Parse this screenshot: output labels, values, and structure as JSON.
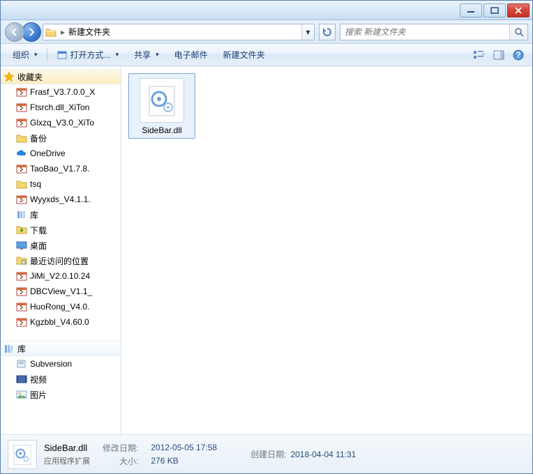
{
  "titlebar": {},
  "address": {
    "folder_name": "新建文件夹",
    "search_placeholder": "搜索 新建文件夹"
  },
  "toolbar": {
    "organize": "组织",
    "open_with": "打开方式...",
    "share": "共享",
    "email": "电子邮件",
    "new_folder": "新建文件夹"
  },
  "sidebar": {
    "favorites_label": "收藏夹",
    "fav_items": [
      {
        "label": "Frasf_V3.7.0.0_X",
        "icon": "archive"
      },
      {
        "label": "Ftsrch.dll_XiTon",
        "icon": "archive"
      },
      {
        "label": "Glxzq_V3.0_XiTo",
        "icon": "archive"
      },
      {
        "label": "备份",
        "icon": "folder"
      },
      {
        "label": "OneDrive",
        "icon": "onedrive"
      },
      {
        "label": "TaoBao_V1.7.8.",
        "icon": "archive"
      },
      {
        "label": "tsq",
        "icon": "folder"
      },
      {
        "label": "Wyyxds_V4.1.1.",
        "icon": "archive"
      },
      {
        "label": "库",
        "icon": "library"
      },
      {
        "label": "下载",
        "icon": "download"
      },
      {
        "label": "桌面",
        "icon": "desktop"
      },
      {
        "label": "最近访问的位置",
        "icon": "recent"
      },
      {
        "label": "JiMi_V2.0.10.24",
        "icon": "archive"
      },
      {
        "label": "DBCView_V1.1_",
        "icon": "archive"
      },
      {
        "label": "HuoRong_V4.0.",
        "icon": "archive"
      },
      {
        "label": "Kgzbbl_V4.60.0",
        "icon": "archive"
      }
    ],
    "libraries_label": "库",
    "lib_items": [
      {
        "label": "Subversion",
        "icon": "library-sub"
      },
      {
        "label": "视频",
        "icon": "library-video"
      },
      {
        "label": "图片",
        "icon": "library-pic"
      }
    ]
  },
  "content": {
    "file": {
      "name": "SideBar.dll"
    }
  },
  "details": {
    "name": "SideBar.dll",
    "type": "应用程序扩展",
    "modified_label": "修改日期:",
    "modified_value": "2012-05-05 17:58",
    "size_label": "大小:",
    "size_value": "276 KB",
    "created_label": "创建日期:",
    "created_value": "2018-04-04 11:31"
  }
}
